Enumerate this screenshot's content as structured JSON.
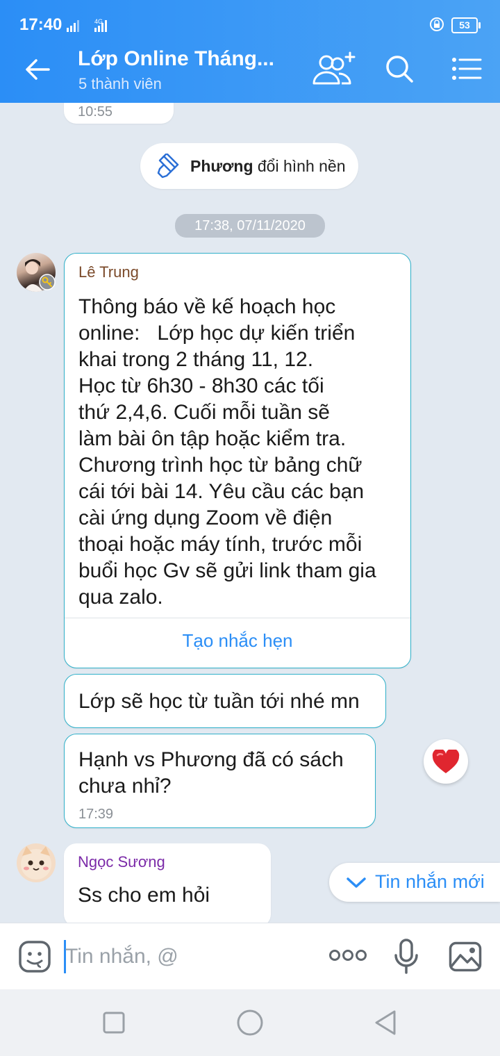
{
  "status_bar": {
    "time": "17:40",
    "network": "4G",
    "battery": "53"
  },
  "header": {
    "title": "Lớp Online Tháng...",
    "subtitle": "5 thành viên",
    "icons": [
      "back-arrow-icon",
      "add-member-icon",
      "search-icon",
      "menu-list-icon"
    ]
  },
  "messages": {
    "prev_time": "10:55",
    "system_notice": {
      "name": "Phương",
      "text": " đổi hình nền"
    },
    "date_chip": "17:38, 07/11/2020",
    "msg1": {
      "sender": "Lê Trung",
      "lines": [
        "Thông báo về kế hoạch học",
        "online:   Lớp học dự kiến triển",
        "khai trong 2 tháng 11, 12.",
        "Học từ 6h30 - 8h30 các tối",
        "thứ 2,4,6. Cuối mỗi tuần sẽ",
        "làm bài ôn tập hoặc kiểm tra.",
        "Chương trình học từ bảng chữ",
        "cái tới bài 14. Yêu cầu các bạn",
        "cài ứng dụng Zoom về điện",
        "thoại hoặc máy tính, trước mỗi",
        "buổi học Gv sẽ gửi link tham gia",
        "qua zalo."
      ],
      "action": "Tạo nhắc hẹn"
    },
    "msg2": {
      "text": "Lớp sẽ học từ tuần tới nhé mn"
    },
    "msg3": {
      "lines": [
        "Hạnh vs Phương đã có sách",
        "chưa nhỉ?"
      ],
      "time": "17:39",
      "reaction": "heart-icon"
    },
    "msg4": {
      "sender": "Ngọc Sương",
      "text": "Ss cho em hỏi"
    },
    "new_messages_button": "Tin nhắn mới"
  },
  "composer": {
    "placeholder": "Tin nhắn, @"
  },
  "colors": {
    "header_blue": "#2b8ef6",
    "link_blue": "#2b8ef6",
    "sender_brown": "#7b4a2a",
    "sender_purple": "#7b2aa8",
    "heart_red": "#e0262f"
  }
}
